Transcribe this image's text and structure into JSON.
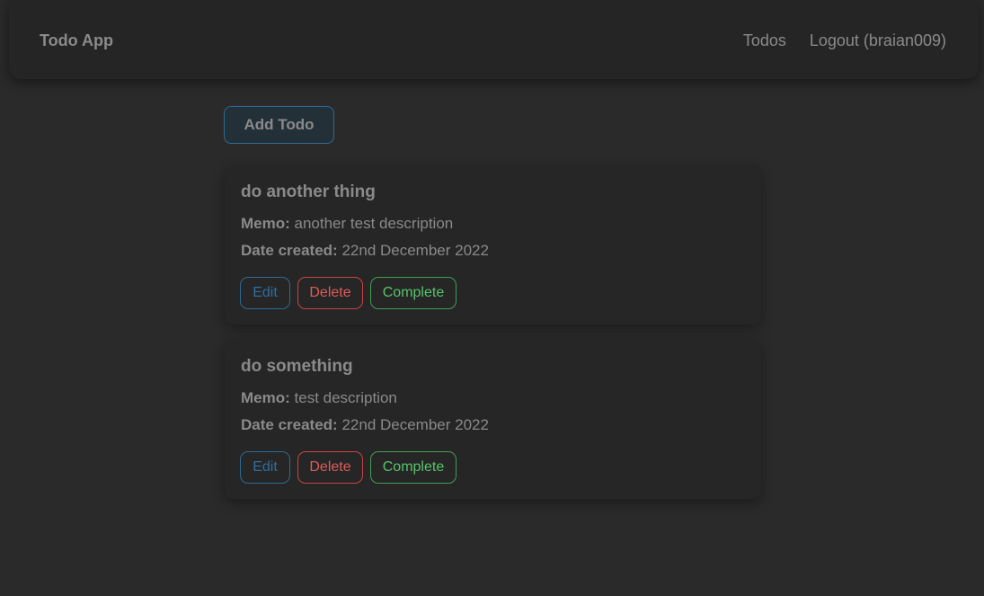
{
  "navbar": {
    "brand": "Todo App",
    "links": [
      {
        "label": "Todos"
      },
      {
        "label": "Logout (braian009)"
      }
    ]
  },
  "actions": {
    "add_label": "Add Todo"
  },
  "labels": {
    "memo": "Memo:",
    "date_created": "Date created:",
    "edit": "Edit",
    "delete": "Delete",
    "complete": "Complete"
  },
  "todos": [
    {
      "title": "do another thing",
      "memo": "another test description",
      "date_created": "22nd December 2022"
    },
    {
      "title": "do something",
      "memo": "test description",
      "date_created": "22nd December 2022"
    }
  ],
  "colors": {
    "background": "#2a2a2a",
    "navbar": "#252525",
    "text": "#8a8a8a",
    "primary": "#2d6a93",
    "danger": "#e05a5a",
    "success": "#56c46a"
  }
}
